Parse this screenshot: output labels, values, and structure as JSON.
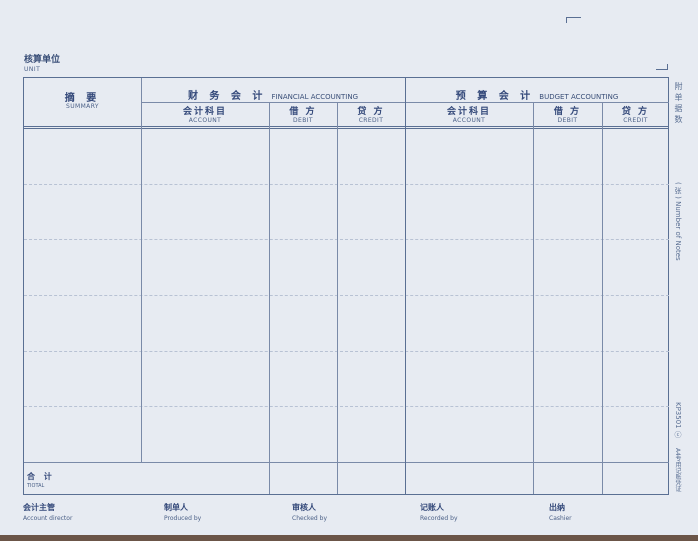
{
  "header": {
    "unit_label": "核算单位",
    "unit_en": "UNIT"
  },
  "table": {
    "summary_zh": "摘  要",
    "summary_en": "SUMMARY",
    "financial_zh": "财 务 会 计",
    "financial_en": "FINANCIAL ACCOUNTING",
    "budget_zh": "预 算 会 计",
    "budget_en": "BUDGET ACCOUNTING",
    "columns": [
      {
        "zh": "会计科目",
        "en": "ACCOUNT"
      },
      {
        "zh": "借 方",
        "en": "DEBIT"
      },
      {
        "zh": "贷 方",
        "en": "CREDIT"
      },
      {
        "zh": "会计科目",
        "en": "ACCOUNT"
      },
      {
        "zh": "借 方",
        "en": "DEBIT"
      },
      {
        "zh": "贷 方",
        "en": "CREDIT"
      }
    ],
    "total_zh": "合 计",
    "total_en": "TIOTAL"
  },
  "signatures": [
    {
      "zh": "会计主管",
      "en": "Account director"
    },
    {
      "zh": "制单人",
      "en": "Produced by"
    },
    {
      "zh": "审核人",
      "en": "Checked by"
    },
    {
      "zh": "记账人",
      "en": "Recorded by"
    },
    {
      "zh": "出纳",
      "en": "Cashier"
    }
  ],
  "side": {
    "attachments": "附单据数",
    "notes": "( 张 )  Number of Notes",
    "code": "KP3501 ⓒ",
    "maker": "A4专用记账凭证"
  }
}
